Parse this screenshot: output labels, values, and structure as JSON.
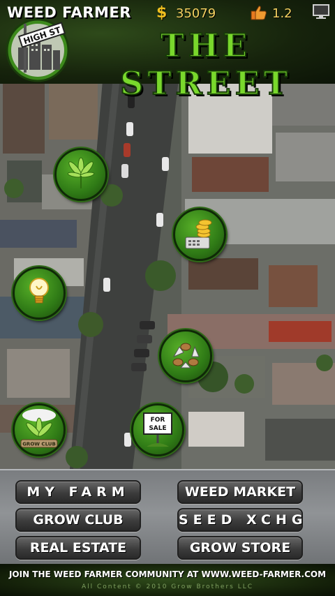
{
  "header": {
    "app_title": "WEED FARMER",
    "cash_symbol": "$",
    "cash": "35079",
    "rating": "1.2",
    "screen_title": "THE STREET",
    "logo_sign_text": "HIGH ST"
  },
  "map_buttons": [
    {
      "name": "farm-map-button",
      "icon": "weed-leaf-icon"
    },
    {
      "name": "market-map-button",
      "icon": "coins-scale-icon"
    },
    {
      "name": "tips-map-button",
      "icon": "lightbulb-icon"
    },
    {
      "name": "seed-exchange-map-button",
      "icon": "seeds-recycle-icon"
    },
    {
      "name": "grow-club-map-button",
      "icon": "grow-club-icon",
      "label": "GROW CLUB"
    },
    {
      "name": "real-estate-map-button",
      "icon": "for-sale-sign-icon",
      "label": "FOR SALE"
    }
  ],
  "menu": {
    "my_farm": "MY FARM",
    "weed_market": "WEED MARKET",
    "grow_club": "GROW CLUB",
    "seed_xchg": "SEED XCHG",
    "real_estate": "REAL ESTATE",
    "grow_store": "GROW STORE"
  },
  "footer": {
    "community_text": "JOIN THE WEED FARMER COMMUNITY AT WWW.WEED-FARMER.COM",
    "copyright": "All Content © 2010 Grow Brothers LLC"
  },
  "colors": {
    "title_green": "#79d82c",
    "gold": "#f3d060",
    "button_green": "#3a8a1c",
    "panel_gray": "#8c8f92"
  }
}
